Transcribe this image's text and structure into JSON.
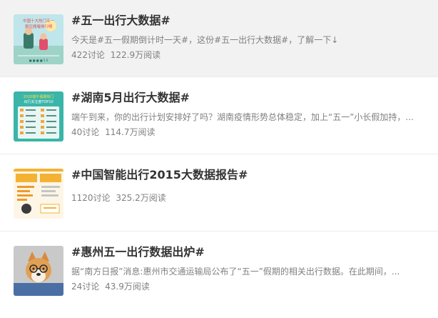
{
  "items": [
    {
      "title": "#五一出行大数据#",
      "desc": "今天是#五一假期倒计时一天#，这份#五一出行大数据#，了解一下↓",
      "discussions": "422讨论",
      "reads": "122.9万阅读",
      "thumb": "travel-data-poster",
      "thumb_text": [
        "中国十大热门五一",
        "景区拥堵排行榜"
      ]
    },
    {
      "title": "#湖南5月出行大数据#",
      "desc": "端午到来，你的出行计划安排好了吗？湖南疫情形势总体稳定，加上“五一”小长假加持，...",
      "discussions": "40讨论",
      "reads": "114.7万阅读",
      "thumb": "hunan-ranking-chart",
      "thumb_text": [
        "2020端午假期热门",
        "出行关注度TOP10"
      ]
    },
    {
      "title": "#中国智能出行2015大数据报告#",
      "desc": "",
      "discussions": "1120讨论",
      "reads": "325.2万阅读",
      "thumb": "smart-travel-infographic",
      "thumb_text": []
    },
    {
      "title": "#惠州五一出行数据出炉#",
      "desc": "据“南方日报”消息:惠州市交通运输局公布了“五一”假期的相关出行数据。在此期间，...",
      "discussions": "24讨论",
      "reads": "43.9万阅读",
      "thumb": "shiba-dog-photo",
      "thumb_text": []
    }
  ],
  "colors": {
    "hover_bg": "#f2f2f2",
    "title": "#333333",
    "meta": "#808080"
  }
}
